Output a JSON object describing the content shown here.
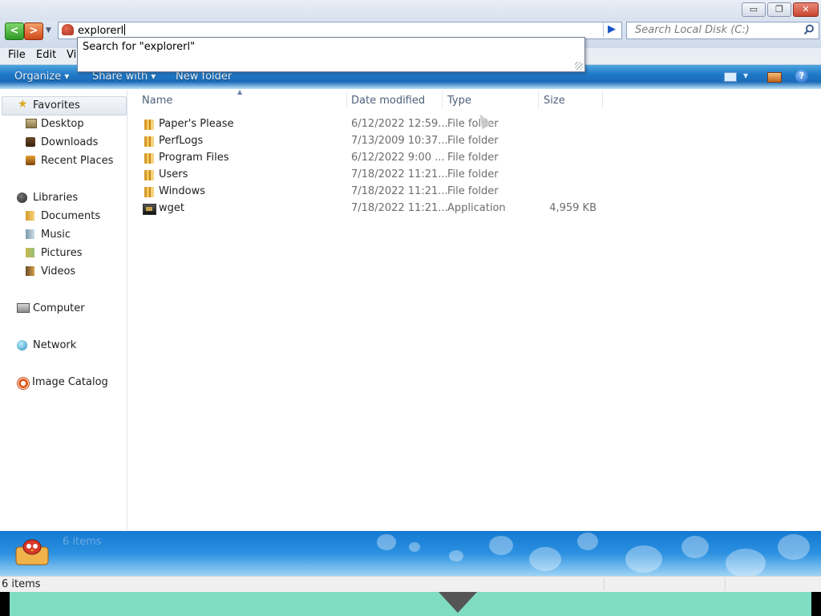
{
  "window": {
    "minimize_label": "▭",
    "restore_label": "❐",
    "close_label": "✕"
  },
  "address": {
    "value": "explorerl",
    "suggestion": "Search for \"explorerl\""
  },
  "search": {
    "placeholder": "Search Local Disk (C:)"
  },
  "menu": [
    "File",
    "Edit",
    "Vi"
  ],
  "command_bar": {
    "organize": "Organize",
    "share_with": "Share with",
    "new_folder": "New folder",
    "help": "?"
  },
  "nav": {
    "favorites": "Favorites",
    "desktop": "Desktop",
    "downloads": "Downloads",
    "recent_places": "Recent Places",
    "libraries": "Libraries",
    "documents": "Documents",
    "music": "Music",
    "pictures": "Pictures",
    "videos": "Videos",
    "computer": "Computer",
    "network": "Network",
    "image_catalog": "Image Catalog"
  },
  "columns": {
    "name": "Name",
    "date_modified": "Date modified",
    "type": "Type",
    "size": "Size"
  },
  "files": [
    {
      "name": "Paper's Please",
      "date": "6/12/2022 12:59...",
      "type": "File folder",
      "size": "",
      "icon": "folder"
    },
    {
      "name": "PerfLogs",
      "date": "7/13/2009 10:37...",
      "type": "File folder",
      "size": "",
      "icon": "folder"
    },
    {
      "name": "Program Files",
      "date": "6/12/2022 9:00 ...",
      "type": "File folder",
      "size": "",
      "icon": "folder"
    },
    {
      "name": "Users",
      "date": "7/18/2022 11:21...",
      "type": "File folder",
      "size": "",
      "icon": "folder"
    },
    {
      "name": "Windows",
      "date": "7/18/2022 11:21...",
      "type": "File folder",
      "size": "",
      "icon": "folder"
    },
    {
      "name": "wget",
      "date": "7/18/2022 11:21...",
      "type": "Application",
      "size": "4,959 KB",
      "icon": "application"
    }
  ],
  "details": {
    "count": "6 items"
  },
  "status": {
    "text": "6 items"
  }
}
